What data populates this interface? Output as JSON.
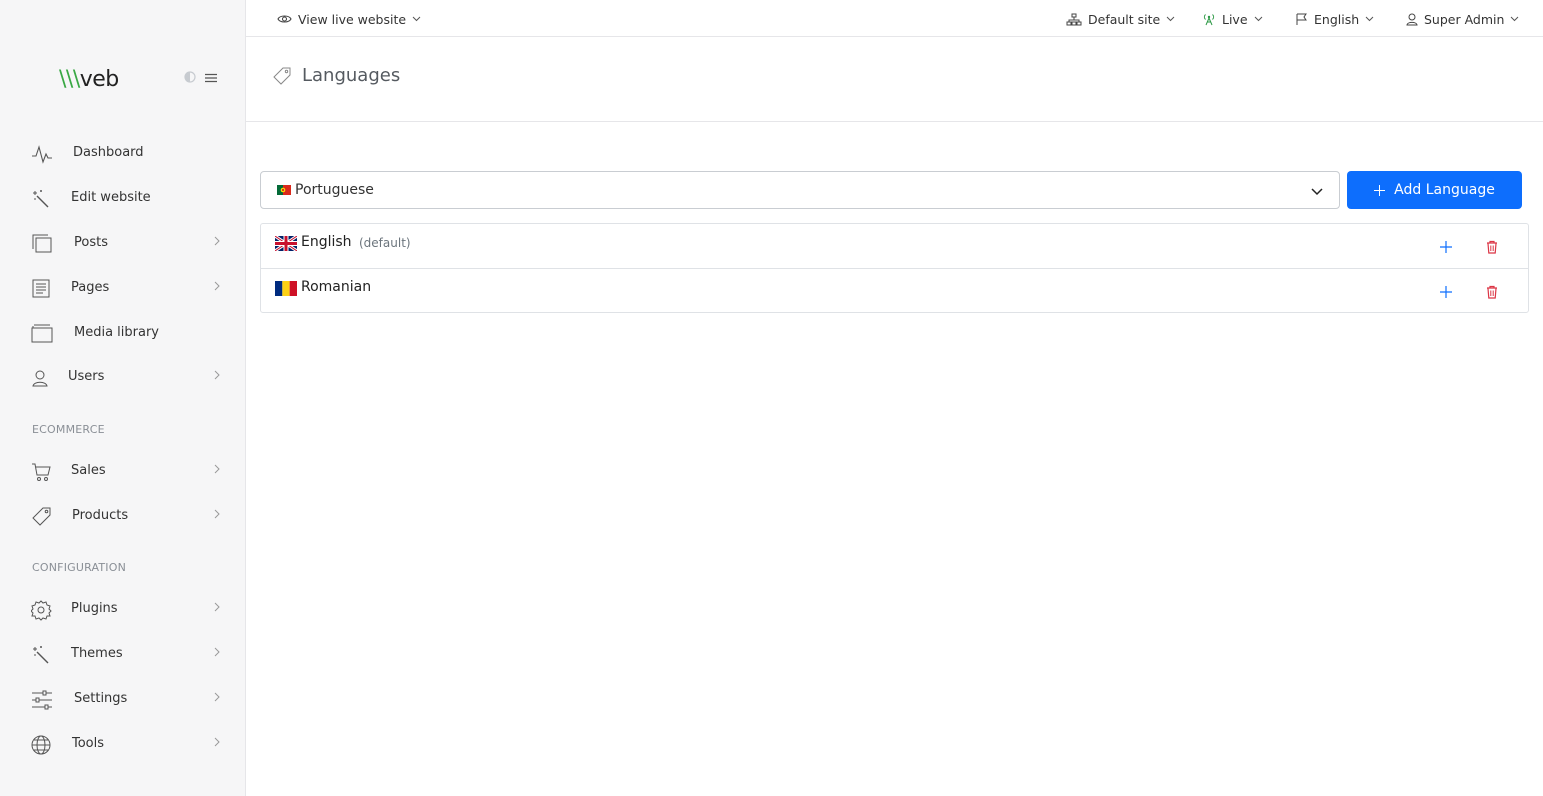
{
  "sidebar": {
    "logo": {
      "slashes": "\\\\\\",
      "text": "veb"
    },
    "items": [
      {
        "label": "Dashboard",
        "icon": "pulse-icon"
      },
      {
        "label": "Edit website",
        "icon": "magic-wand-icon"
      },
      {
        "label": "Posts",
        "icon": "copy-icon",
        "has_submenu": true
      },
      {
        "label": "Pages",
        "icon": "document-lines-icon",
        "has_submenu": true
      },
      {
        "label": "Media library",
        "icon": "folder-icon"
      },
      {
        "label": "Users",
        "icon": "user-icon",
        "has_submenu": true
      },
      {
        "label": "Sales",
        "icon": "cart-icon",
        "has_submenu": true
      },
      {
        "label": "Products",
        "icon": "tag-icon",
        "has_submenu": true
      },
      {
        "label": "Plugins",
        "icon": "gear-icon",
        "has_submenu": true
      },
      {
        "label": "Themes",
        "icon": "magic-wand-icon",
        "has_submenu": true
      },
      {
        "label": "Settings",
        "icon": "sliders-icon",
        "has_submenu": true
      },
      {
        "label": "Tools",
        "icon": "globe-icon",
        "has_submenu": true
      }
    ],
    "sections": {
      "ecommerce": "ECOMMERCE",
      "configuration": "CONFIGURATION"
    }
  },
  "topbar": {
    "view_live": "View live website",
    "site": "Default site",
    "status": "Live",
    "language": "English",
    "user": "Super Admin"
  },
  "page": {
    "title": "Languages",
    "select_value": "Portuguese",
    "add_button": "Add Language"
  },
  "languages": [
    {
      "name": "English",
      "badge": "(default)",
      "flag": "uk"
    },
    {
      "name": "Romanian",
      "flag": "ro"
    }
  ],
  "colors": {
    "primary": "#0d6efd",
    "danger": "#dc3545",
    "logo_green": "#3aa845",
    "live_green": "#2e9a47"
  }
}
